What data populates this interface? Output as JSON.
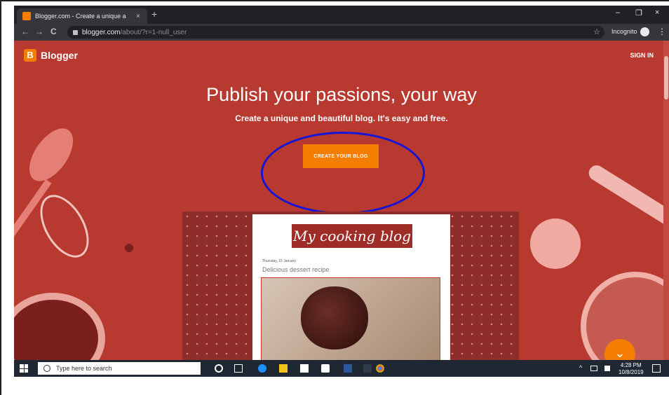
{
  "browser": {
    "tab_title": "Blogger.com - Create a unique a",
    "tab_close": "×",
    "new_tab": "+",
    "window_controls": [
      "–",
      "❐",
      "×"
    ],
    "nav": {
      "back": "←",
      "forward": "→",
      "reload": "C"
    },
    "url_host": "blogger.com",
    "url_path": "/about/?r=1-null_user",
    "star": "☆",
    "profile_label": "Incognito",
    "menu": "⋮"
  },
  "page": {
    "brand": "Blogger",
    "brand_letter": "B",
    "sign_in": "SIGN IN",
    "headline": "Publish your passions, your way",
    "subline": "Create a unique and beautiful blog. It's easy and free.",
    "cta": "CREATE YOUR BLOG",
    "preview": {
      "blog_title": "My cooking blog",
      "date": "Thursday, 15 January",
      "post_title": "Delicious dessert recipe"
    },
    "fab": "⌄"
  },
  "taskbar": {
    "search_placeholder": "Type here to search",
    "time": "4:28 PM",
    "date": "10/8/2019"
  },
  "colors": {
    "page_bg": "#b7392f",
    "accent": "#f57d00",
    "highlight_ring": "#1515d8"
  }
}
